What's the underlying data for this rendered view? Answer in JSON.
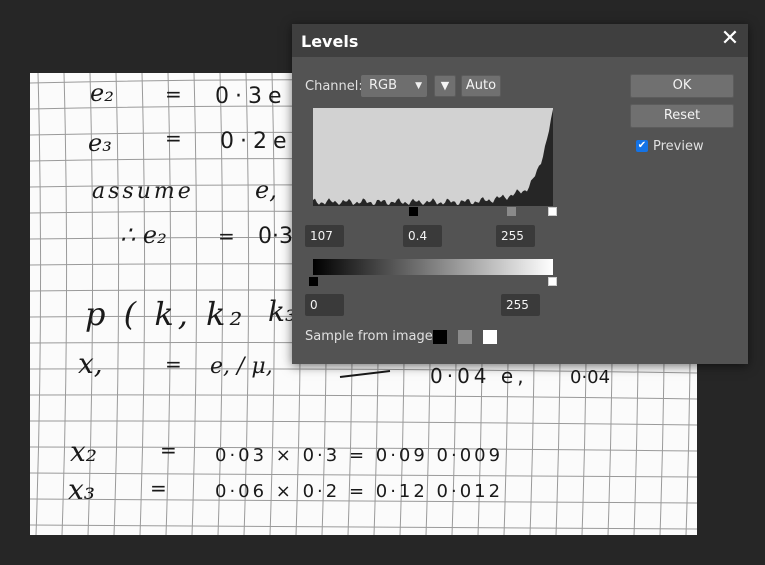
{
  "dialog": {
    "title": "Levels",
    "channel_label": "Channel:",
    "channel_value": "RGB",
    "auto_label": "Auto",
    "ok_label": "OK",
    "reset_label": "Reset",
    "preview_label": "Preview",
    "preview_checked": true,
    "input_black": "107",
    "input_gamma": "0.4",
    "input_white": "255",
    "output_black": "0",
    "output_white": "255",
    "sample_label": "Sample from image:",
    "accent_color": "#1473e6"
  },
  "document": {
    "lines": [
      {
        "lhs": "e₂",
        "op": "=",
        "rhs": "0·3e"
      },
      {
        "lhs": "e₃",
        "op": "=",
        "rhs": "0·2e"
      },
      {
        "lhs": "assume",
        "op": "",
        "rhs": "e,"
      },
      {
        "lhs": "∴ e₂",
        "op": "=",
        "rhs": "0·3"
      },
      {
        "lhs": "p ( k, k₂",
        "op": "",
        "rhs": "k₃"
      },
      {
        "lhs": "x,",
        "op": "=",
        "rhs": "e, / μ,"
      },
      {
        "lhs": "0·04 e,",
        "op": "=",
        "rhs": "0·04"
      },
      {
        "lhs": "x₂",
        "op": "=",
        "rhs": "0·03 × 0·3 = 0·09 0·009"
      },
      {
        "lhs": "x₃",
        "op": "=",
        "rhs": "0·06 × 0·2 = 0·12 0·012"
      }
    ]
  }
}
